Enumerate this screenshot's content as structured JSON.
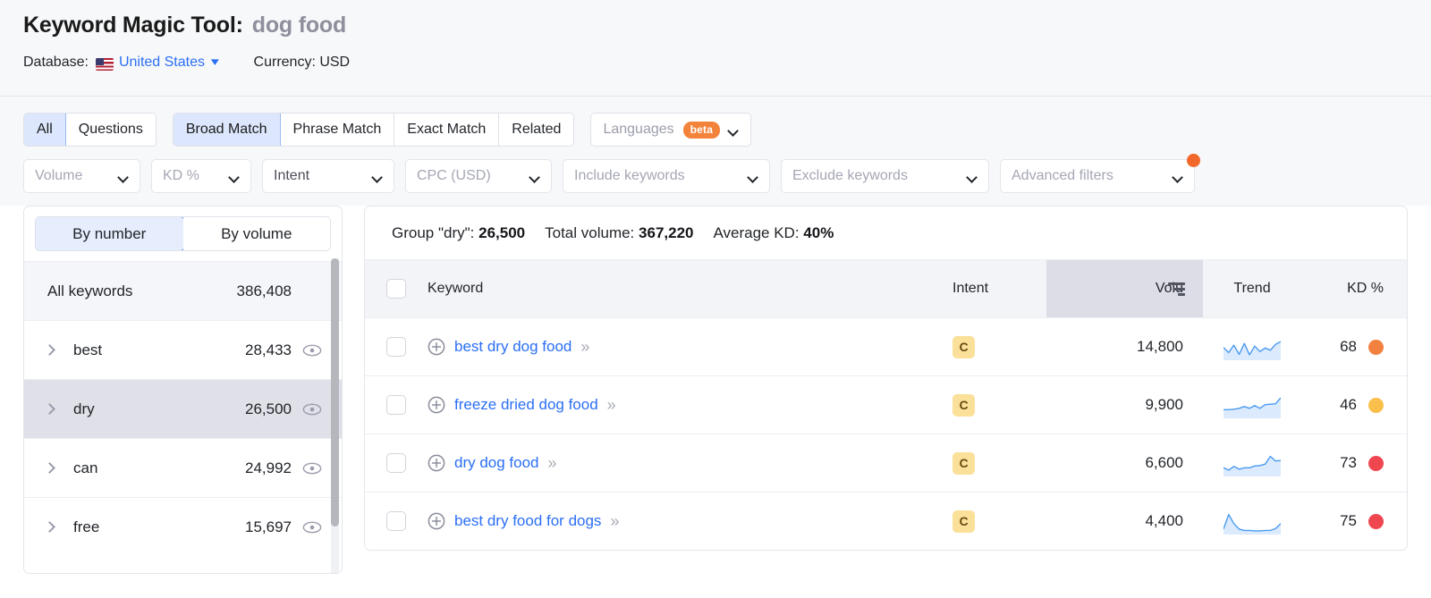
{
  "header": {
    "title_main": "Keyword Magic Tool:",
    "title_term": "dog food",
    "database_label": "Database:",
    "database_value": "United States",
    "currency_label": "Currency: USD"
  },
  "match_tabs": {
    "group_one": [
      {
        "label": "All",
        "active": true
      },
      {
        "label": "Questions",
        "active": false
      }
    ],
    "group_two": [
      {
        "label": "Broad Match",
        "active": true
      },
      {
        "label": "Phrase Match",
        "active": false
      },
      {
        "label": "Exact Match",
        "active": false
      },
      {
        "label": "Related",
        "active": false
      }
    ],
    "languages": {
      "label": "Languages",
      "badge": "beta"
    }
  },
  "filters": [
    {
      "label": "Volume",
      "muted": true
    },
    {
      "label": "KD %",
      "muted": true
    },
    {
      "label": "Intent",
      "muted": false
    },
    {
      "label": "CPC (USD)",
      "muted": true
    },
    {
      "label": "Include keywords",
      "muted": true
    },
    {
      "label": "Exclude keywords",
      "muted": true
    },
    {
      "label": "Advanced filters",
      "muted": true,
      "notification": true
    }
  ],
  "sidebar": {
    "toggle": [
      {
        "label": "By number",
        "active": true
      },
      {
        "label": "By volume",
        "active": false
      }
    ],
    "all_keywords": {
      "label": "All keywords",
      "count": "386,408"
    },
    "groups": [
      {
        "label": "best",
        "count": "28,433",
        "selected": false
      },
      {
        "label": "dry",
        "count": "26,500",
        "selected": true
      },
      {
        "label": "can",
        "count": "24,992",
        "selected": false
      },
      {
        "label": "free",
        "count": "15,697",
        "selected": false
      }
    ]
  },
  "summary": {
    "group_label": "Group \"dry\":",
    "group_value": "26,500",
    "total_label": "Total volume:",
    "total_value": "367,220",
    "kd_label": "Average KD:",
    "kd_value": "40%"
  },
  "table": {
    "columns": {
      "keyword": "Keyword",
      "intent": "Intent",
      "volume": "Volu",
      "trend": "Trend",
      "kd": "KD %"
    },
    "sorted_column": "volume",
    "rows": [
      {
        "keyword": "best dry dog food",
        "intent": "C",
        "volume": "14,800",
        "kd": "68",
        "kd_color": "#f2813f",
        "trend": [
          52,
          30,
          62,
          22,
          70,
          20,
          58,
          34,
          50,
          40,
          66,
          78
        ]
      },
      {
        "keyword": "freeze dried dog food",
        "intent": "C",
        "volume": "9,900",
        "kd": "46",
        "kd_color": "#fbc04b",
        "trend": [
          34,
          34,
          36,
          40,
          48,
          40,
          52,
          40,
          56,
          58,
          60,
          86
        ]
      },
      {
        "keyword": "dry dog food",
        "intent": "C",
        "volume": "6,600",
        "kd": "73",
        "kd_color": "#ef4650",
        "trend": [
          34,
          24,
          40,
          28,
          34,
          34,
          42,
          44,
          50,
          84,
          64,
          66
        ]
      },
      {
        "keyword": "best dry food for dogs",
        "intent": "C",
        "volume": "4,400",
        "kd": "75",
        "kd_color": "#ef4650",
        "trend": [
          20,
          84,
          44,
          20,
          14,
          14,
          12,
          12,
          14,
          14,
          22,
          44
        ]
      }
    ]
  },
  "colors": {
    "link": "#2b6ff5",
    "accent_orange": "#f2682a",
    "selected_tab_bg": "#dce7fd",
    "intent_badge_bg": "#fbe09a",
    "spark_line": "#4a9bf0",
    "spark_fill": "#dbeafc"
  }
}
